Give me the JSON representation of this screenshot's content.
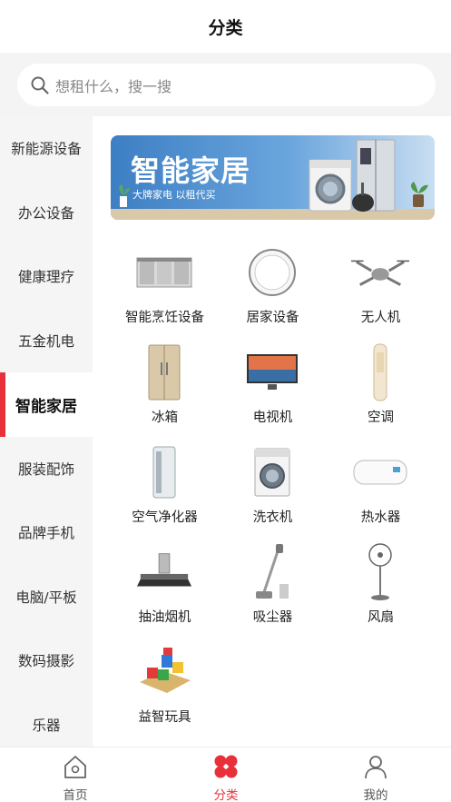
{
  "header": {
    "title": "分类"
  },
  "search": {
    "placeholder": "想租什么，搜一搜"
  },
  "sidebar": {
    "items": [
      {
        "label": "新能源设备"
      },
      {
        "label": "办公设备"
      },
      {
        "label": "健康理疗"
      },
      {
        "label": "五金机电"
      },
      {
        "label": "智能家居",
        "active": true
      },
      {
        "label": "服装配饰"
      },
      {
        "label": "品牌手机"
      },
      {
        "label": "电脑/平板"
      },
      {
        "label": "数码摄影"
      },
      {
        "label": "乐器"
      }
    ]
  },
  "banner": {
    "title": "智能家居",
    "subtitle": "大牌家电  以租代买"
  },
  "categories": [
    {
      "label": "智能烹饪设备",
      "icon": "kitchen-appliance-icon"
    },
    {
      "label": "居家设备",
      "icon": "robot-vacuum-icon"
    },
    {
      "label": "无人机",
      "icon": "drone-icon"
    },
    {
      "label": "冰箱",
      "icon": "refrigerator-icon"
    },
    {
      "label": "电视机",
      "icon": "television-icon"
    },
    {
      "label": "空调",
      "icon": "air-conditioner-icon"
    },
    {
      "label": "空气净化器",
      "icon": "air-purifier-icon"
    },
    {
      "label": "洗衣机",
      "icon": "washing-machine-icon"
    },
    {
      "label": "热水器",
      "icon": "water-heater-icon"
    },
    {
      "label": "抽油烟机",
      "icon": "range-hood-icon"
    },
    {
      "label": "吸尘器",
      "icon": "vacuum-cleaner-icon"
    },
    {
      "label": "风扇",
      "icon": "fan-icon"
    },
    {
      "label": "益智玩具",
      "icon": "puzzle-toy-icon"
    }
  ],
  "tabbar": {
    "tabs": [
      {
        "label": "首页",
        "icon": "home-icon"
      },
      {
        "label": "分类",
        "icon": "category-icon",
        "active": true
      },
      {
        "label": "我的",
        "icon": "profile-icon"
      }
    ]
  },
  "colors": {
    "accent": "#e8303a",
    "sidebar_bg": "#f5f5f5",
    "page_bg": "#f4f4f4"
  }
}
